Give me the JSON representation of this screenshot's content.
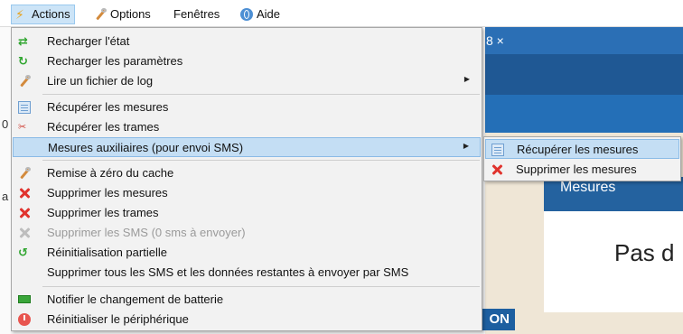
{
  "menubar": {
    "items": [
      {
        "label": "Actions",
        "icon": "lightning-icon"
      },
      {
        "label": "Options",
        "icon": "wrench-icon"
      },
      {
        "label": "Fenêtres",
        "icon": ""
      },
      {
        "label": "Aide",
        "icon": "globe-help-icon"
      }
    ]
  },
  "background": {
    "tab_text": "8 ×",
    "card_title": "Mesures",
    "card_text": "Pas d",
    "button_text": "ON",
    "left_glyphs": [
      "0",
      "a"
    ]
  },
  "menu": {
    "items": [
      {
        "label": "Recharger l'état",
        "icon": "reload-state-icon",
        "enabled": true
      },
      {
        "label": "Recharger les paramètres",
        "icon": "reload-settings-icon",
        "enabled": true
      },
      {
        "label": "Lire un fichier de log",
        "icon": "wrench-icon",
        "enabled": true,
        "submenu": true
      },
      {
        "label": "Récupérer les mesures",
        "icon": "document-icon",
        "enabled": true
      },
      {
        "label": "Récupérer les trames",
        "icon": "frames-icon",
        "enabled": true
      },
      {
        "label": "Mesures auxiliaires (pour envoi SMS)",
        "icon": "",
        "enabled": true,
        "submenu": true,
        "highlighted": true
      },
      {
        "label": "Remise à zéro du cache",
        "icon": "wrench-icon",
        "enabled": true
      },
      {
        "label": "Supprimer les mesures",
        "icon": "delete-icon",
        "enabled": true
      },
      {
        "label": "Supprimer les trames",
        "icon": "delete-icon",
        "enabled": true
      },
      {
        "label": "Supprimer les SMS (0 sms à envoyer)",
        "icon": "delete-icon",
        "enabled": false
      },
      {
        "label": "Réinitialisation partielle",
        "icon": "green-arrow-icon",
        "enabled": true
      },
      {
        "label": "Supprimer tous les SMS et les données restantes à envoyer par SMS",
        "icon": "",
        "enabled": true
      },
      {
        "label": "Notifier le changement de batterie",
        "icon": "battery-icon",
        "enabled": true
      },
      {
        "label": "Réinitialiser le périphérique",
        "icon": "power-icon",
        "enabled": true
      }
    ]
  },
  "submenu": {
    "items": [
      {
        "label": "Récupérer les mesures",
        "icon": "document-icon",
        "highlighted": true
      },
      {
        "label": "Supprimer les mesures",
        "icon": "delete-icon"
      }
    ]
  },
  "colors": {
    "menu_highlight": "#c4def4",
    "delete_red": "#e0332d",
    "app_blue": "#2b6fb5"
  }
}
